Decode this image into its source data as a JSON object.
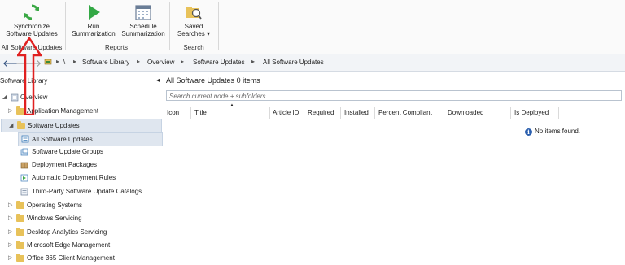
{
  "ribbon": {
    "sync_line1": "Synchronize",
    "sync_line2": "Software Updates",
    "group_all_updates": "All Software Updates",
    "run_line1": "Run",
    "run_line2": "Summarization",
    "sched_line1": "Schedule",
    "sched_line2": "Summarization",
    "group_reports": "Reports",
    "saved_line1": "Saved",
    "saved_line2": "Searches ▾",
    "group_search": "Search"
  },
  "address": {
    "root": "\\",
    "crumbs": [
      "Software Library",
      "Overview",
      "Software Updates",
      "All Software Updates"
    ]
  },
  "sidebar": {
    "header": "Software Library",
    "items": [
      {
        "label": "Overview"
      },
      {
        "label": "Application Management"
      },
      {
        "label": "Software Updates"
      },
      {
        "label": "All Software Updates"
      },
      {
        "label": "Software Update Groups"
      },
      {
        "label": "Deployment Packages"
      },
      {
        "label": "Automatic Deployment Rules"
      },
      {
        "label": "Third-Party Software Update Catalogs"
      },
      {
        "label": "Operating Systems"
      },
      {
        "label": "Windows Servicing"
      },
      {
        "label": "Desktop Analytics Servicing"
      },
      {
        "label": "Microsoft Edge Management"
      },
      {
        "label": "Office 365 Client Management"
      }
    ]
  },
  "main": {
    "title": "All Software Updates",
    "count": "0 items",
    "search_placeholder": "Search current node + subfolders",
    "columns": [
      "Icon",
      "Title",
      "Article ID",
      "Required",
      "Installed",
      "Percent Compliant",
      "Downloaded",
      "Is Deployed"
    ],
    "empty_text": "No items found."
  },
  "colors": {
    "accent_arrow": "#e02020",
    "selection": "#dfe6ef"
  }
}
